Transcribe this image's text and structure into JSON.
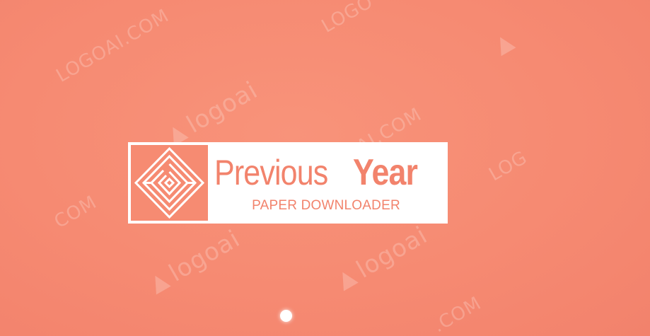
{
  "logo": {
    "title_light": "Previous",
    "title_bold": "Year",
    "subtitle": "PAPER DOWNLOADER",
    "brand_color": "#f2836c",
    "background_color": "#f68b72",
    "emblem_icon": "nested-diamond-maze-icon"
  },
  "watermark": {
    "domain_text": "LOGOAI.COM",
    "brand_text": "logoai",
    "partial_texts": [
      "LOGO",
      "COM",
      ".COM",
      "LOG",
      "AI.COM"
    ]
  },
  "indicator": {
    "type": "loading-dot",
    "color": "#ffffff"
  }
}
